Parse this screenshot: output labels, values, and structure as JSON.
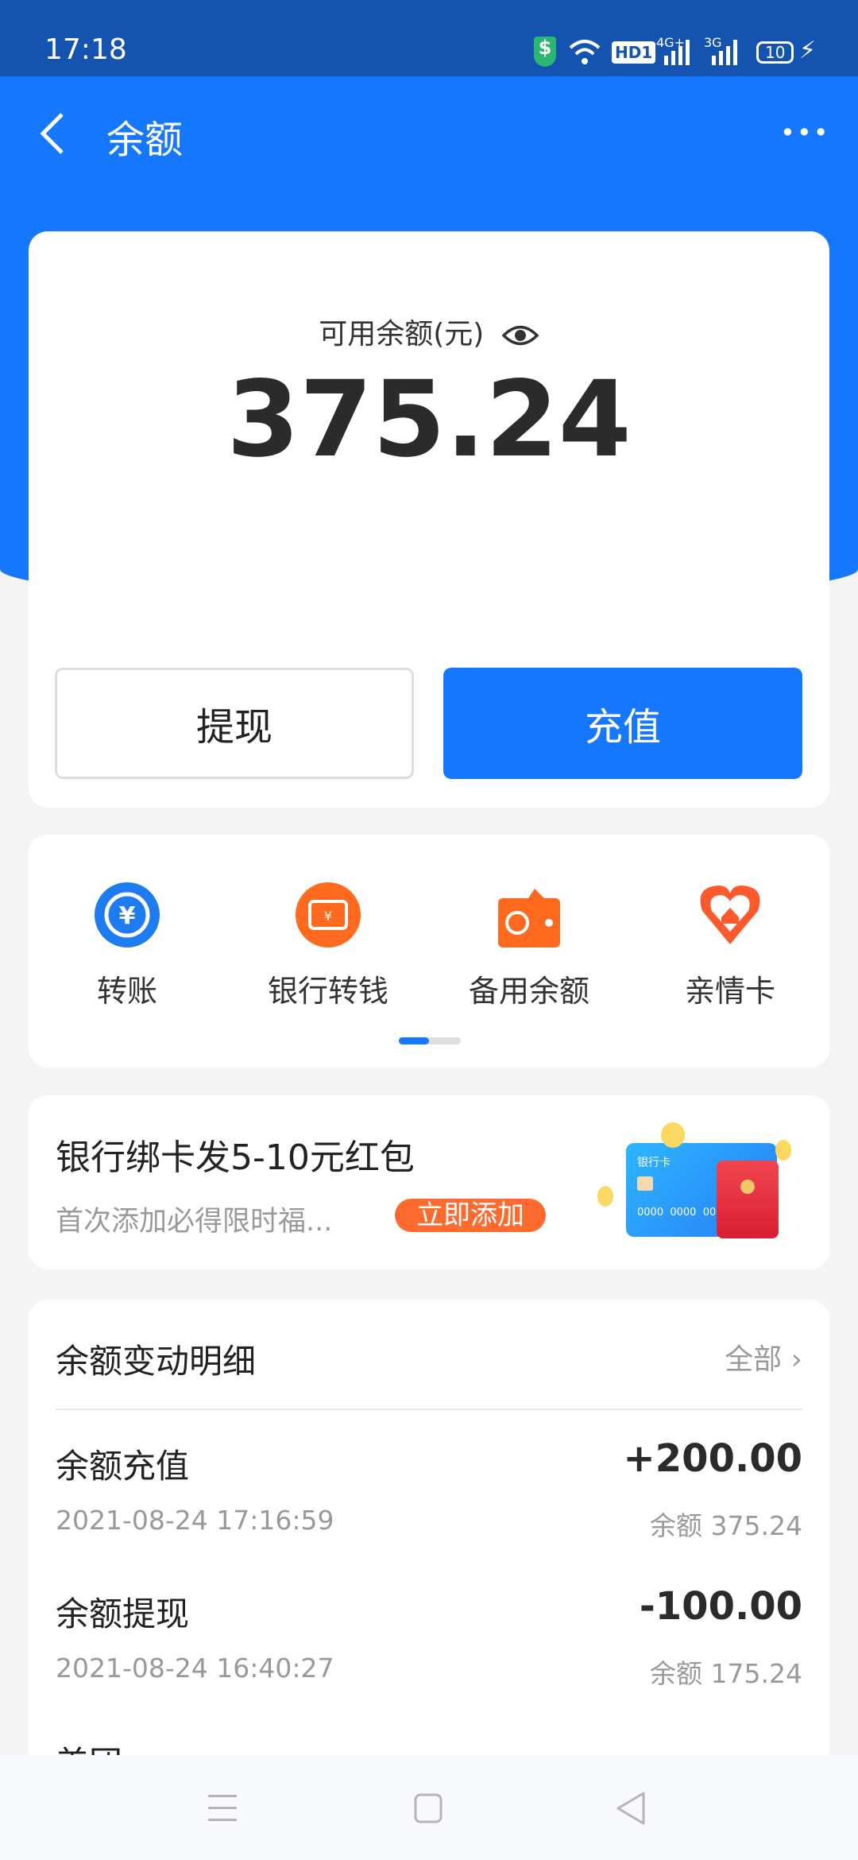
{
  "status_bar": {
    "time": "17:18",
    "battery": "10",
    "network1": "4G+",
    "network2": "3G",
    "hd": "HD1"
  },
  "header": {
    "title": "余额",
    "more": "•••"
  },
  "balance": {
    "label": "可用余额(元)",
    "amount": "375.24",
    "withdraw": "提现",
    "recharge": "充值"
  },
  "quick": {
    "items": [
      {
        "label": "转账",
        "icon": "transfer-icon"
      },
      {
        "label": "银行转钱",
        "icon": "bank-transfer-icon"
      },
      {
        "label": "备用余额",
        "icon": "wallet-icon"
      },
      {
        "label": "亲情卡",
        "icon": "heart-home-icon"
      }
    ],
    "page_index": 1,
    "page_count": 2
  },
  "promo": {
    "title": "银行绑卡发5-10元红包",
    "subtitle": "首次添加必得限时福...",
    "button": "立即添加",
    "card_label": "银行卡",
    "card_number": "0000  0000  00"
  },
  "history": {
    "title": "余额变动明细",
    "all": "全部",
    "rows": [
      {
        "name": "余额充值",
        "time": "2021-08-24 17:16:59",
        "amount": "+200.00",
        "balance": "余额 375.24"
      },
      {
        "name": "余额提现",
        "time": "2021-08-24 16:40:27",
        "amount": "-100.00",
        "balance": "余额 175.24"
      },
      {
        "name": "美团"
      }
    ]
  },
  "colors": {
    "primary": "#1677ff",
    "orange": "#ff6a2a",
    "status": "#1553b0"
  }
}
